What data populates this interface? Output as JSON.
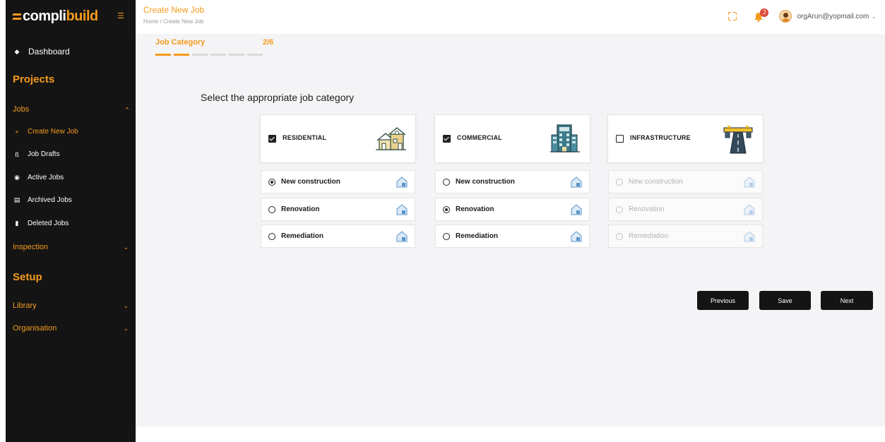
{
  "brand": {
    "part1": "compli",
    "part2": "build",
    "accent": "#f59a1c"
  },
  "sidebar": {
    "dashboard": "Dashboard",
    "projects_title": "Projects",
    "jobs": "Jobs",
    "job_items": [
      {
        "label": "Create New Job",
        "icon": "plus-icon",
        "active": true
      },
      {
        "label": "Job Drafts",
        "icon": "drafts-icon"
      },
      {
        "label": "Active Jobs",
        "icon": "active-icon"
      },
      {
        "label": "Archived Jobs",
        "icon": "archive-icon"
      },
      {
        "label": "Deleted Jobs",
        "icon": "trash-icon"
      }
    ],
    "inspection": "Inspection",
    "setup_title": "Setup",
    "library": "Library",
    "organisation": "Organisation"
  },
  "header": {
    "title": "Create New Job",
    "breadcrumb": "Home / Create New Job",
    "notifications": "2",
    "user_email": "orgArun@yopmail.com"
  },
  "stepper": {
    "label": "Job Category",
    "count": "2/6",
    "total_steps": 6,
    "completed_steps": 2
  },
  "prompt": "Select the appropriate job category",
  "categories": [
    {
      "name": "RESIDENTIAL",
      "checked": true,
      "options": [
        {
          "label": "New construction",
          "selected": true
        },
        {
          "label": "Renovation",
          "selected": false
        },
        {
          "label": "Remediation",
          "selected": false
        }
      ]
    },
    {
      "name": "COMMERCIAL",
      "checked": true,
      "options": [
        {
          "label": "New construction",
          "selected": false
        },
        {
          "label": "Renovation",
          "selected": true
        },
        {
          "label": "Remediation",
          "selected": false
        }
      ]
    },
    {
      "name": "INFRASTRUCTURE",
      "checked": false,
      "options": [
        {
          "label": "New construction",
          "selected": false
        },
        {
          "label": "Renovation",
          "selected": false
        },
        {
          "label": "Remediation",
          "selected": false
        }
      ]
    }
  ],
  "buttons": {
    "previous": "Previous",
    "save": "Save",
    "next": "Next"
  }
}
